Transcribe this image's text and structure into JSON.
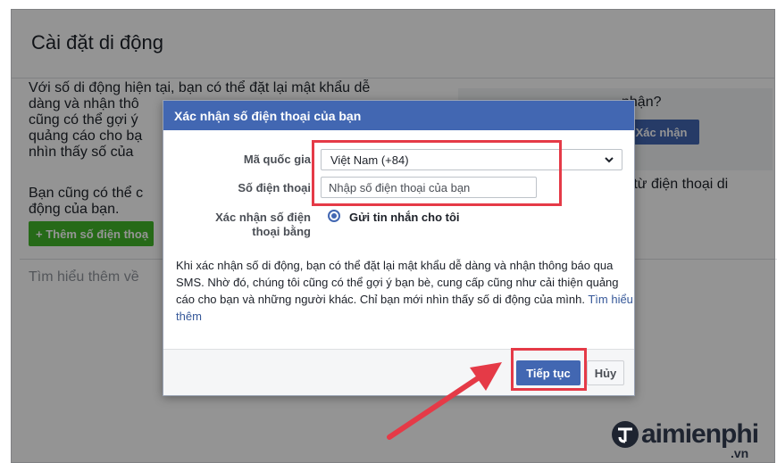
{
  "page": {
    "title": "Cài đặt di động",
    "bg_paragraph_1": "Với số di động hiện tại, bạn có thể đặt lại mật khẩu dễ\ndàng và nhận thô\ncũng có thể gợi ý\nquảng cáo cho bạ\nnhìn thấy số của",
    "bg_paragraph_2": "Bạn cũng có thể c\nđộng của bạn.",
    "bg_right_question": "nhận?",
    "bg_confirm_button": "Xác nhận",
    "bg_right_text": "n từ điện thoại di",
    "bg_add_button": "+ Thêm số điện thoạ",
    "bg_learn_more": "Tìm hiểu thêm về"
  },
  "dialog": {
    "title": "Xác nhận số điện thoại của bạn",
    "country_label": "Mã quốc gia",
    "country_value": "Việt Nam (+84)",
    "phone_label": "Số điện thoại",
    "phone_placeholder": "Nhập số điện thoại của bạn",
    "phone_value": "",
    "verify_label_1": "Xác nhận số điện",
    "verify_label_2": "thoại bằng",
    "verify_option": "Gửi tin nhắn cho tôi",
    "description": "Khi xác nhận số di động, bạn có thể đặt lại mật khẩu dễ dàng và nhận thông báo qua SMS. Nhờ đó, chúng tôi cũng có thể gợi ý bạn bè, cung cấp cũng như cải thiện quảng cáo cho bạn và những người khác. Chỉ bạn mới nhìn thấy số di động của mình.",
    "learn_more": "Tìm hiểu thêm",
    "continue_button": "Tiếp tục",
    "cancel_button": "Hủy"
  },
  "watermark": {
    "brand": "aimienphi",
    "suffix": ".vn"
  },
  "colors": {
    "header": "#4267b2",
    "highlight": "#e53a47",
    "add_button": "#42b72a"
  },
  "icons": [
    "chevron-down-icon",
    "radio-icon",
    "arrow-icon",
    "taimienphi-logo-icon"
  ]
}
